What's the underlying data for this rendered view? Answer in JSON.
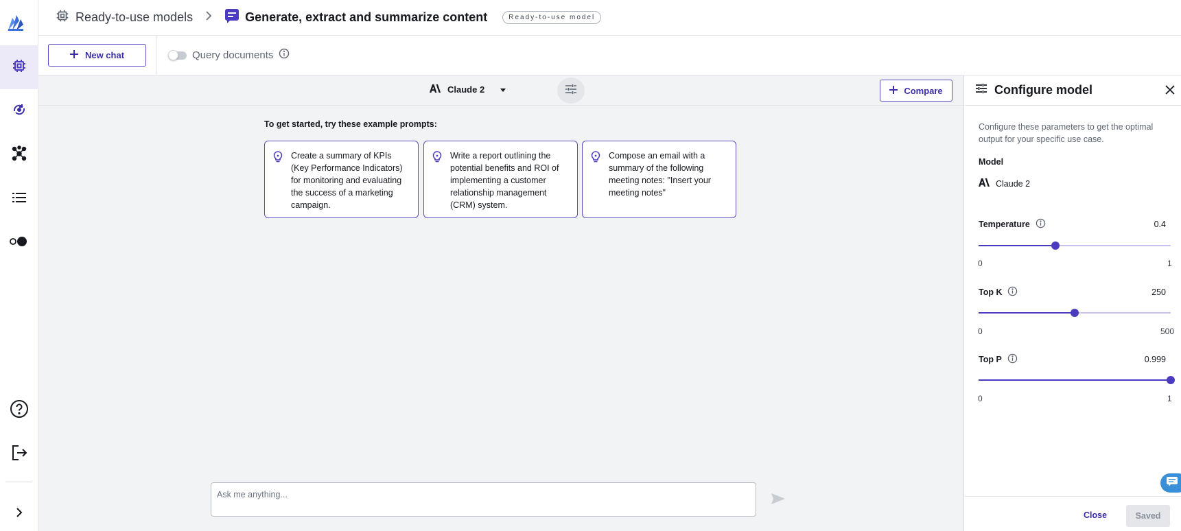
{
  "header": {
    "breadcrumb_root": "Ready-to-use models",
    "page_title": "Generate, extract and summarize content",
    "badge": "Ready-to-use model"
  },
  "toolbar": {
    "new_chat_label": "New chat",
    "query_documents_label": "Query documents",
    "query_documents_enabled": false
  },
  "model_bar": {
    "selected_model": "Claude 2",
    "compare_label": "Compare"
  },
  "prompts": {
    "title": "To get started, try these example prompts:",
    "items": [
      {
        "text": "Create a summary of KPIs (Key Performance Indicators) for monitoring and evaluating the success of a marketing campaign."
      },
      {
        "text": "Write a report outlining the potential benefits and ROI of implementing a customer relationship management (CRM) system."
      },
      {
        "text": "Compose an email with a summary of the following meeting notes: \"Insert your meeting notes\""
      }
    ]
  },
  "chat_input": {
    "placeholder": "Ask me anything..."
  },
  "configure_panel": {
    "title": "Configure model",
    "description": "Configure these parameters to get the optimal output for your specific use case.",
    "model_label": "Model",
    "model_name": "Claude 2",
    "params": [
      {
        "label": "Temperature",
        "value": "0.4",
        "min": "0",
        "max": "1",
        "fraction": 0.4
      },
      {
        "label": "Top K",
        "value": "250",
        "min": "0",
        "max": "500",
        "fraction": 0.5
      },
      {
        "label": "Top P",
        "value": "0.999",
        "min": "0",
        "max": "1",
        "fraction": 0.999
      }
    ],
    "close_label": "Close",
    "saved_label": "Saved"
  },
  "colors": {
    "accent": "#4a3bc0",
    "accent_text": "#3b2fa8",
    "background": "#f2f3f5"
  }
}
